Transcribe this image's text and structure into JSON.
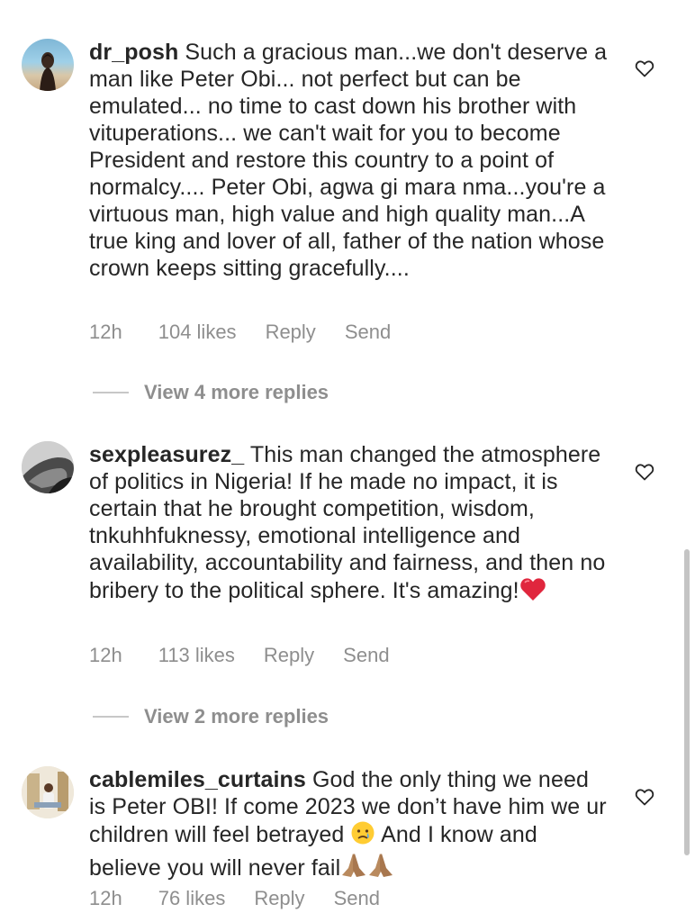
{
  "comments": [
    {
      "username": "dr_posh",
      "text": " Such a gracious man...we don't deserve a man like Peter Obi... not perfect but can be emulated... no time to cast down his brother with vituperations... we can't wait for you to become President and restore this country to a point of normalcy.... Peter Obi, agwa gi mara nma...you're a virtuous man, high value and high quality man...A true king and lover of all, father of the nation whose crown keeps sitting gracefully....",
      "time": "12h",
      "likes": "104 likes",
      "reply": "Reply",
      "send": "Send",
      "view_more": "View 4 more replies"
    },
    {
      "username": "sexpleasurez_",
      "text": " This man changed the atmosphere of politics in Nigeria! If he made no impact, it is certain that he brought competition, wisdom, tnkuhhfuknessy, emotional intelligence and availability, accountability and fairness, and then no bribery to the political sphere. It's amazing!",
      "time": "12h",
      "likes": "113 likes",
      "reply": "Reply",
      "send": "Send",
      "view_more": "View 2 more replies"
    },
    {
      "username": "cablemiles_curtains",
      "text": " God the only thing we need is Peter OBI! If come 2023 we don’t have him we ur children will feel betrayed ",
      "text2": " And I know and believe you will never fail",
      "time": "12h",
      "likes": "76 likes",
      "reply": "Reply",
      "send": "Send"
    }
  ],
  "icons": {
    "like": "heart-outline-icon",
    "emoji_heart": "red-heart-emoji",
    "emoji_cry": "crying-face-emoji",
    "emoji_pray": "folded-hands-emoji"
  },
  "colors": {
    "text": "#262626",
    "muted": "#8e8e8e",
    "heart": "#e0263d"
  }
}
